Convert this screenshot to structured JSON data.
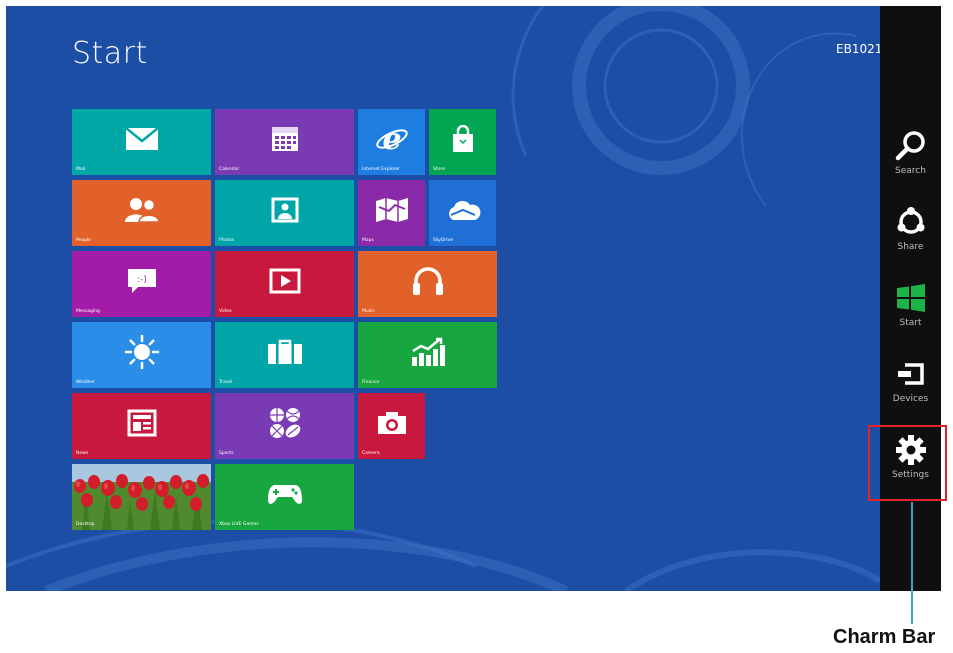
{
  "start": {
    "title": "Start",
    "user_name": "EB1021"
  },
  "tiles": [
    {
      "label": "Mail",
      "icon": "mail-icon",
      "color": "#00a7a7"
    },
    {
      "label": "Calendar",
      "icon": "calendar-icon",
      "color": "#7a3ab4"
    },
    {
      "label": "Internet Explorer",
      "icon": "internet-explorer-icon",
      "color": "#1e7de0"
    },
    {
      "label": "Store",
      "icon": "store-bag-icon",
      "color": "#00a651"
    },
    {
      "label": "People",
      "icon": "people-icon",
      "color": "#e2612a"
    },
    {
      "label": "Photos",
      "icon": "photos-icon",
      "color": "#00a5a8"
    },
    {
      "label": "Maps",
      "icon": "maps-icon",
      "color": "#8b2aa8"
    },
    {
      "label": "SkyDrive",
      "icon": "skydrive-cloud-icon",
      "color": "#1f6fd6"
    },
    {
      "label": "Messaging",
      "icon": "messaging-icon",
      "color": "#a21ca8"
    },
    {
      "label": "Video",
      "icon": "video-play-icon",
      "color": "#c9183d"
    },
    {
      "label": "Music",
      "icon": "headphones-icon",
      "color": "#e2612a"
    },
    {
      "label": "Weather",
      "icon": "sun-icon",
      "color": "#2a8ee8"
    },
    {
      "label": "Travel",
      "icon": "suitcase-icon",
      "color": "#00a5a8"
    },
    {
      "label": "Finance",
      "icon": "finance-chart-icon",
      "color": "#17a63f"
    },
    {
      "label": "News",
      "icon": "newspaper-icon",
      "color": "#c9183d"
    },
    {
      "label": "Sports",
      "icon": "sports-balls-icon",
      "color": "#7a3ab4"
    },
    {
      "label": "Camera",
      "icon": "camera-icon",
      "color": "#c9183d"
    },
    {
      "label": "Desktop",
      "icon": "desktop-tulips-image",
      "color": "#5f8f3a"
    },
    {
      "label": "Xbox LIVE Games",
      "icon": "xbox-controller-icon",
      "color": "#17a63f"
    }
  ],
  "charms": [
    {
      "label": "Search",
      "icon": "search-icon"
    },
    {
      "label": "Share",
      "icon": "share-icon"
    },
    {
      "label": "Start",
      "icon": "windows-logo-icon"
    },
    {
      "label": "Devices",
      "icon": "devices-icon"
    },
    {
      "label": "Settings",
      "icon": "gear-icon"
    }
  ],
  "colors": {
    "screen_background": "#1d4ea6",
    "charm_bar": "#0f0f0f",
    "highlight": "#e0232c",
    "callout_line": "#3ea0c8"
  },
  "annotation": {
    "label": "Charm Bar"
  }
}
